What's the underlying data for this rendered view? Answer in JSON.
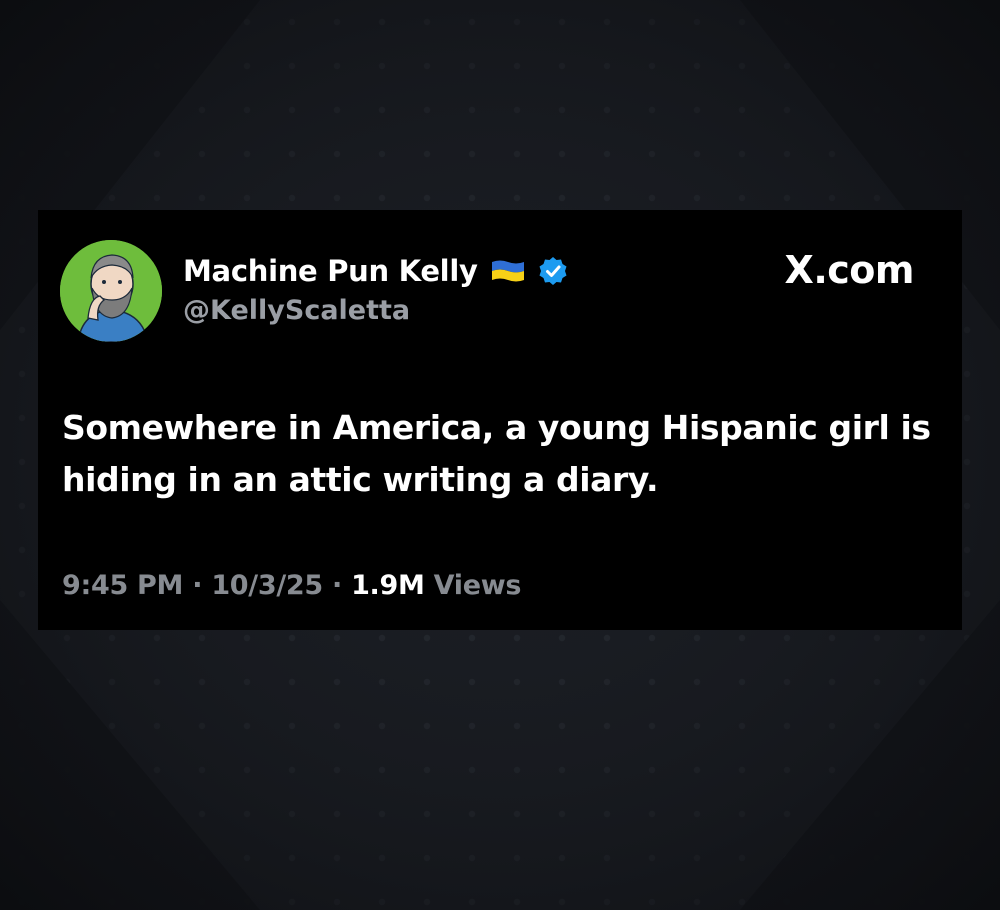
{
  "tweet": {
    "display_name": "Machine Pun Kelly",
    "handle": "@KellyScaletta",
    "brand": "X.com",
    "text": "Somewhere in America, a young Hispanic girl is hiding in an attic writing a diary.",
    "time": "9:45 PM",
    "date": "10/3/25",
    "separator": "·",
    "views_count": "1.9M",
    "views_label": "Views",
    "flag_icon": "ukraine-flag-icon",
    "verified_icon": "verified-badge-icon",
    "verified_color": "#1d9bf0",
    "flag_colors": [
      "#2f6fd6",
      "#f7d117"
    ]
  }
}
